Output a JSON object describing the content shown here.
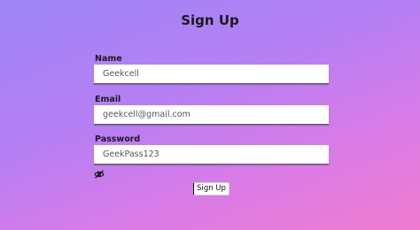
{
  "page": {
    "title": "Sign Up"
  },
  "form": {
    "name": {
      "label": "Name",
      "value": "Geekcell"
    },
    "email": {
      "label": "Email",
      "value": "geekcell@gmail.com"
    },
    "password": {
      "label": "Password",
      "value": "GeekPass123"
    },
    "password_toggle_icon": "eye-slash-icon",
    "submit_label": "Sign Up"
  },
  "colors": {
    "background_start": "#9e86f6",
    "background_end": "#f07ccf",
    "input_background": "#ffffff"
  }
}
